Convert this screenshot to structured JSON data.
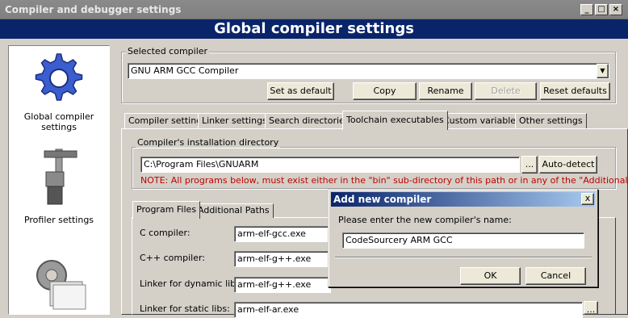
{
  "window": {
    "title": "Compiler and debugger settings",
    "header": "Global compiler settings"
  },
  "sidebar": {
    "items": [
      {
        "label": "Global compiler settings",
        "icon": "gear-icon"
      },
      {
        "label": "Profiler settings",
        "icon": "caliper-icon"
      },
      {
        "label": "",
        "icon": "gear-stack-icon"
      }
    ]
  },
  "selected_compiler": {
    "legend": "Selected compiler",
    "value": "GNU ARM GCC Compiler",
    "buttons": {
      "set_default": "Set as default",
      "copy": "Copy",
      "rename": "Rename",
      "delete": "Delete",
      "reset_defaults": "Reset defaults"
    }
  },
  "tabs": [
    "Compiler settings",
    "Linker settings",
    "Search directories",
    "Toolchain executables",
    "Custom variables",
    "Other settings"
  ],
  "install_dir": {
    "legend": "Compiler's installation directory",
    "value": "C:\\Program Files\\GNUARM",
    "browse": "...",
    "auto_detect": "Auto-detect",
    "note": "NOTE: All programs below, must exist either in the \"bin\" sub-directory of this path or in any of the \"Additional"
  },
  "subtabs": [
    "Program Files",
    "Additional Paths"
  ],
  "programs": [
    {
      "label": "C compiler:",
      "value": "arm-elf-gcc.exe"
    },
    {
      "label": "C++ compiler:",
      "value": "arm-elf-g++.exe"
    },
    {
      "label": "Linker for dynamic libs:",
      "value": "arm-elf-g++.exe"
    },
    {
      "label": "Linker for static libs:",
      "value": "arm-elf-ar.exe"
    }
  ],
  "dialog": {
    "title": "Add new compiler",
    "prompt": "Please enter the new compiler's name:",
    "value": "CodeSourcery ARM GCC",
    "ok": "OK",
    "cancel": "Cancel",
    "close": "x"
  },
  "colors": {
    "header_bg": "#0a246a",
    "note_text": "#c00000"
  }
}
